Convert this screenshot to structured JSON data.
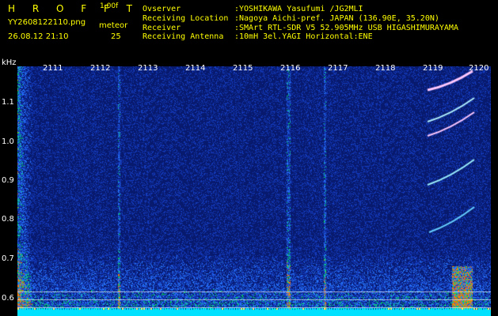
{
  "header": {
    "title": "H R O F F T",
    "version": "1.00f",
    "filename": "YY2608122110.png",
    "datetime": "26.08.12 21:10",
    "meteor_label": "meteor",
    "meteor_count": "25"
  },
  "info": [
    {
      "key": "Ovserver",
      "value": ":YOSHIKAWA Yasufumi /JG2MLI"
    },
    {
      "key": "Receiving Location",
      "value": ":Nagoya Aichi-pref. JAPAN (136.90E, 35.20N)"
    },
    {
      "key": "Receiver",
      "value": ":SMArt RTL-SDR V5 52.905MHz USB HIGASHIMURAYAMA"
    },
    {
      "key": "Receiving Antenna",
      "value": ":10mH 3el.YAGI Horizontal:ENE"
    }
  ],
  "axis": {
    "y_unit": "kHz",
    "y_ticks": [
      "1.1",
      "1.0",
      "0.9",
      "0.8",
      "0.7",
      "0.6"
    ],
    "x_ticks": [
      "2111",
      "2112",
      "2113",
      "2114",
      "2115",
      "2116",
      "2117",
      "2118",
      "2119",
      "2120"
    ]
  },
  "colors": {
    "background": "#000000",
    "header_yellow": "#ffff00",
    "value_cyan": "#00ffff",
    "spectrum_base": "#0a1a7a",
    "grid": "#ffffff"
  }
}
